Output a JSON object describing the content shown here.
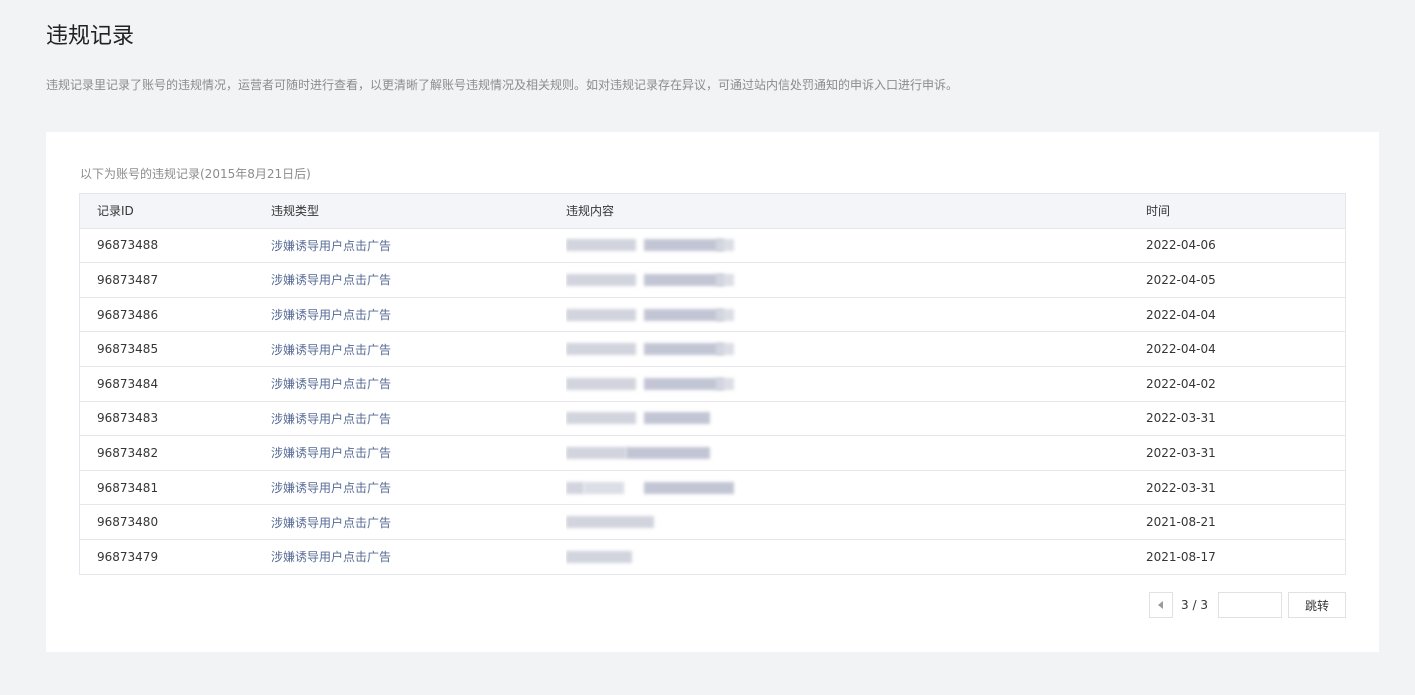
{
  "page": {
    "title": "违规记录",
    "description": "违规记录里记录了账号的违规情况，运营者可随时进行查看，以更清晰了解账号违规情况及相关规则。如对违规记录存在异议，可通过站内信处罚通知的申诉入口进行申诉。"
  },
  "table": {
    "caption": "以下为账号的违规记录(2015年8月21日后)",
    "headers": [
      "记录ID",
      "违规类型",
      "违规内容",
      "时间"
    ],
    "rows": [
      {
        "id": "96873488",
        "type": "涉嫌诱导用户点击广告",
        "time": "2022-04-06"
      },
      {
        "id": "96873487",
        "type": "涉嫌诱导用户点击广告",
        "time": "2022-04-05"
      },
      {
        "id": "96873486",
        "type": "涉嫌诱导用户点击广告",
        "time": "2022-04-04"
      },
      {
        "id": "96873485",
        "type": "涉嫌诱导用户点击广告",
        "time": "2022-04-04"
      },
      {
        "id": "96873484",
        "type": "涉嫌诱导用户点击广告",
        "time": "2022-04-02"
      },
      {
        "id": "96873483",
        "type": "涉嫌诱导用户点击广告",
        "time": "2022-03-31"
      },
      {
        "id": "96873482",
        "type": "涉嫌诱导用户点击广告",
        "time": "2022-03-31"
      },
      {
        "id": "96873481",
        "type": "涉嫌诱导用户点击广告",
        "time": "2022-03-31"
      },
      {
        "id": "96873480",
        "type": "涉嫌诱导用户点击广告",
        "time": "2021-08-21"
      },
      {
        "id": "96873479",
        "type": "涉嫌诱导用户点击广告",
        "time": "2021-08-17"
      }
    ]
  },
  "pagination": {
    "page_indicator": "3 / 3",
    "jump_input_value": "",
    "jump_label": "跳转"
  },
  "colors": {
    "page_background": "#f2f3f5",
    "card_background": "#ffffff",
    "header_background": "#f4f5f9",
    "link_text": "#576b95",
    "muted_text": "#8c8c8c"
  }
}
